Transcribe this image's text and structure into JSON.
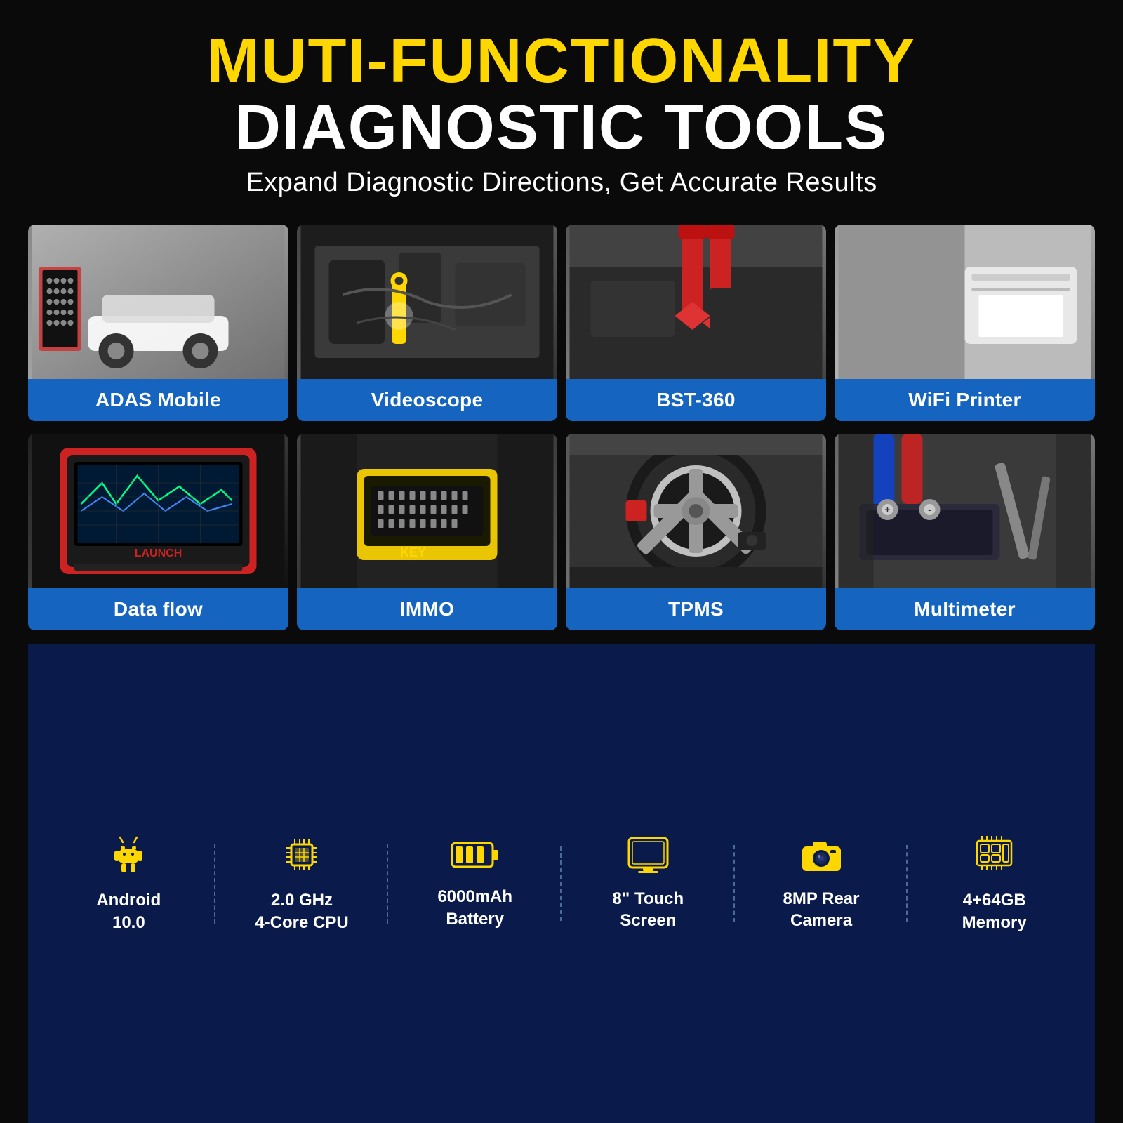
{
  "header": {
    "title_yellow": "MUTI-FUNCTIONALITY",
    "title_white": "DIAGNOSTIC TOOLS",
    "subtitle": "Expand Diagnostic Directions, Get Accurate Results"
  },
  "grid_row1": [
    {
      "id": "adas",
      "label": "ADAS Mobile"
    },
    {
      "id": "videoscope",
      "label": "Videoscope"
    },
    {
      "id": "bst",
      "label": "BST-360"
    },
    {
      "id": "wifi",
      "label": "WiFi Printer"
    }
  ],
  "grid_row2": [
    {
      "id": "dataflow",
      "label": "Data flow"
    },
    {
      "id": "immo",
      "label": "IMMO"
    },
    {
      "id": "tpms",
      "label": "TPMS"
    },
    {
      "id": "multimeter",
      "label": "Multimeter"
    }
  ],
  "specs": [
    {
      "id": "android",
      "icon": "android",
      "line1": "Android",
      "line2": "10.0"
    },
    {
      "id": "cpu",
      "icon": "cpu",
      "line1": "2.0 GHz",
      "line2": "4-Core CPU"
    },
    {
      "id": "battery",
      "icon": "battery",
      "line1": "6000mAh",
      "line2": "Battery"
    },
    {
      "id": "screen",
      "icon": "screen",
      "line1": "8\" Touch",
      "line2": "Screen"
    },
    {
      "id": "camera",
      "icon": "camera",
      "line1": "8MP Rear",
      "line2": "Camera"
    },
    {
      "id": "memory",
      "icon": "memory",
      "line1": "4+64GB",
      "line2": "Memory"
    }
  ],
  "colors": {
    "yellow": "#FFD700",
    "white": "#FFFFFF",
    "blue_label": "#1565C0",
    "dark_bg": "#0a0a0a",
    "navy_bg": "#0a1a4a"
  }
}
